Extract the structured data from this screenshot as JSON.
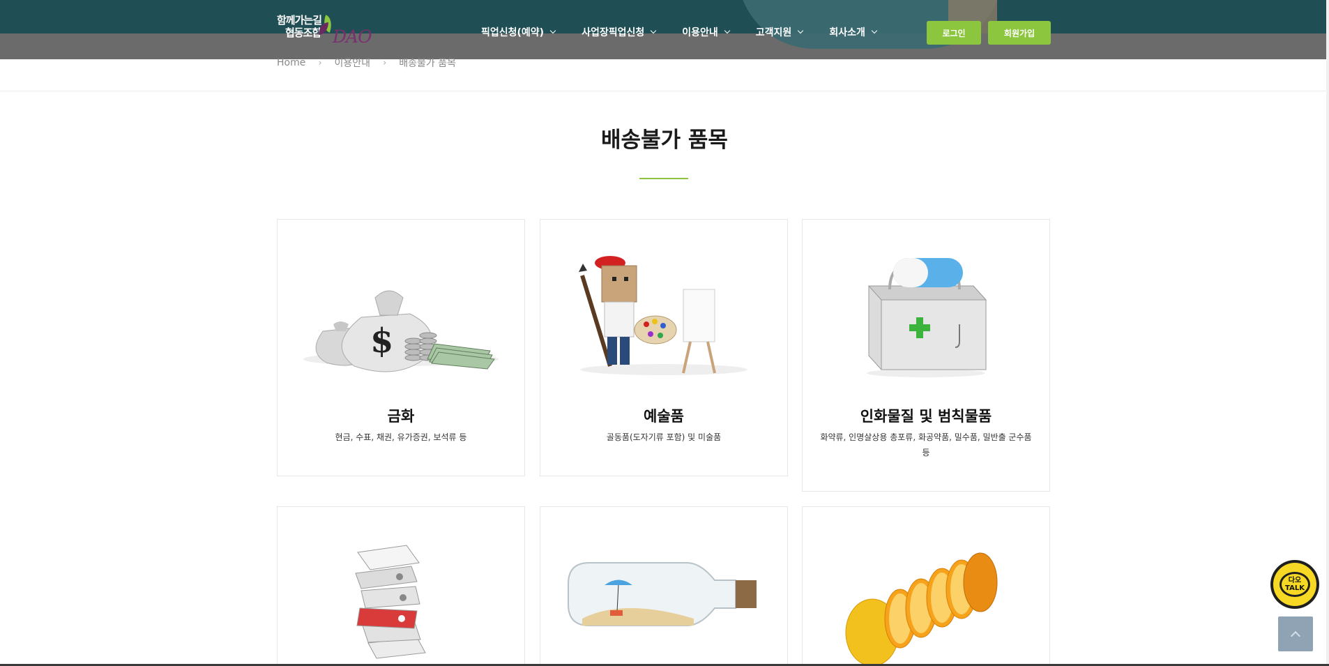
{
  "logo": {
    "line1": "함께가는길",
    "line2": "협동조합",
    "brand": "DAO"
  },
  "nav": [
    {
      "label": "픽업신청(예약)"
    },
    {
      "label": "사업장픽업신청"
    },
    {
      "label": "이용안내"
    },
    {
      "label": "고객지원"
    },
    {
      "label": "회사소개"
    }
  ],
  "buttons": {
    "login": "로그인",
    "signup": "회원가입"
  },
  "breadcrumb": [
    "Home",
    "이용안내",
    "배송불가 품목"
  ],
  "page": {
    "title": "배송불가 품목"
  },
  "cards": [
    {
      "name": "금화",
      "desc": "현금, 수표, 채권, 유가증권, 보석류 등",
      "icon": "money-bags-icon"
    },
    {
      "name": "예술품",
      "desc": "골동품(도자기류 포함) 및 미술품",
      "icon": "artist-palette-icon"
    },
    {
      "name": "인화물질 및 범칙물품",
      "desc": "화약류, 인명살상용 총포류, 화공약품, 밀수품, 밀반출 군수품 등",
      "icon": "medicine-box-icon"
    },
    {
      "name": "",
      "desc": "",
      "icon": "document-files-icon"
    },
    {
      "name": "",
      "desc": "",
      "icon": "bottle-icon"
    },
    {
      "name": "",
      "desc": "",
      "icon": "orange-slices-icon"
    }
  ],
  "floating": {
    "talk_line1": "다오",
    "talk_line2": "TALK"
  },
  "colors": {
    "header": "#1f4f54",
    "accent": "#8cc63e",
    "talk": "#f7d824"
  }
}
